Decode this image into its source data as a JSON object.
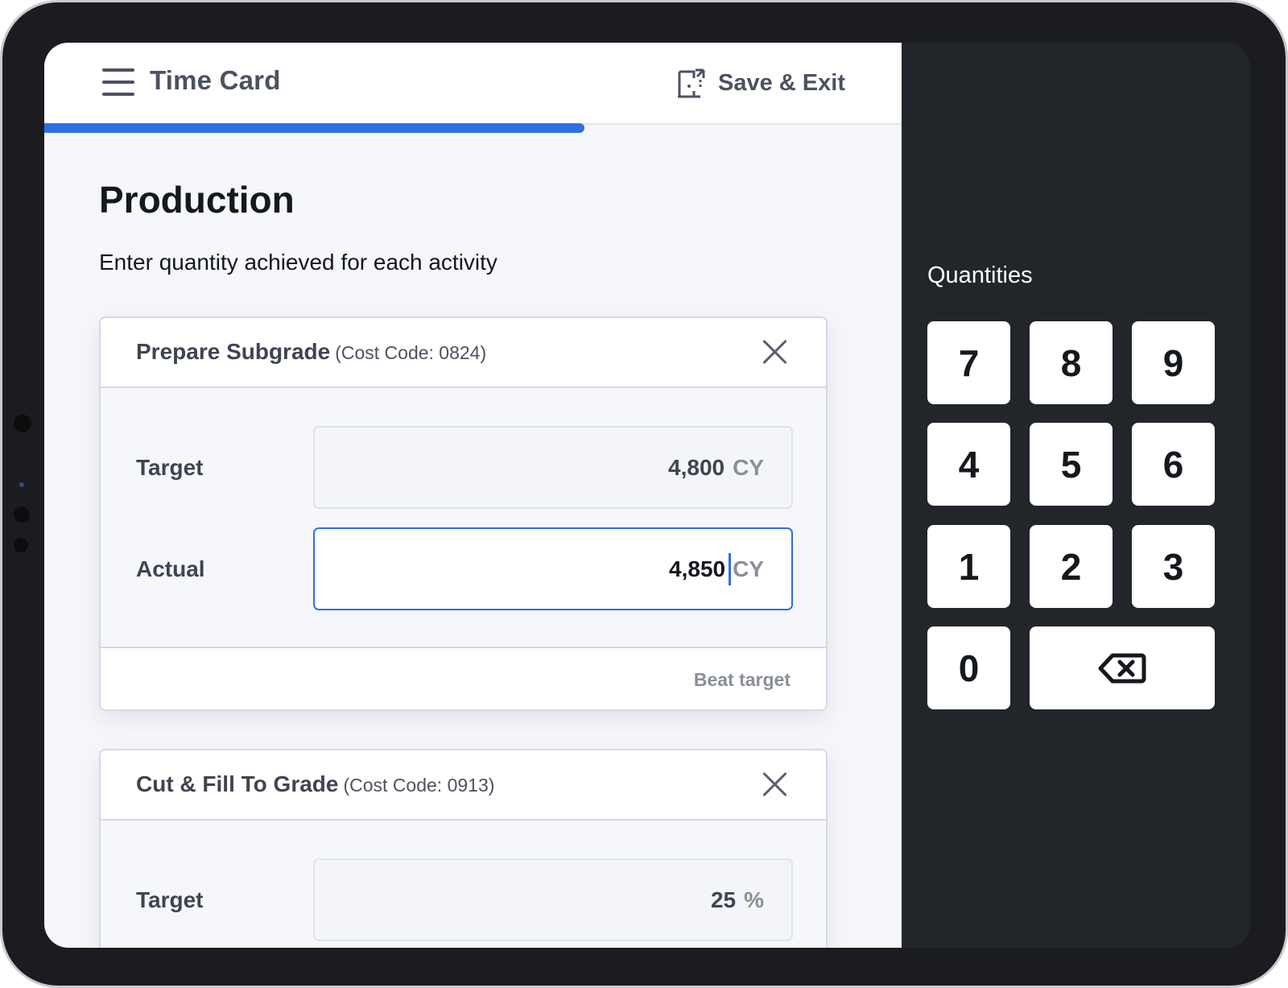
{
  "header": {
    "title": "Time Card",
    "save_exit_label": "Save & Exit",
    "progress_percent": 63
  },
  "page": {
    "title": "Production",
    "subtitle": "Enter quantity achieved for each activity"
  },
  "activities": [
    {
      "name": "Prepare Subgrade",
      "cost_code": "(Cost Code: 0824)",
      "target_label": "Target",
      "target_value": "4,800",
      "target_unit": "CY",
      "actual_label": "Actual",
      "actual_value": "4,850",
      "actual_unit": "CY",
      "status": "Beat target"
    },
    {
      "name": "Cut & Fill To Grade",
      "cost_code": "(Cost Code: 0913)",
      "target_label": "Target",
      "target_value": "25",
      "target_unit": "%"
    }
  ],
  "keypad": {
    "title": "Quantities",
    "keys": [
      "7",
      "8",
      "9",
      "4",
      "5",
      "6",
      "1",
      "2",
      "3",
      "0"
    ],
    "backspace_icon": "backspace-icon"
  },
  "colors": {
    "accent": "#2f6fe4",
    "panel": "#22252a",
    "text": "#15181d"
  }
}
